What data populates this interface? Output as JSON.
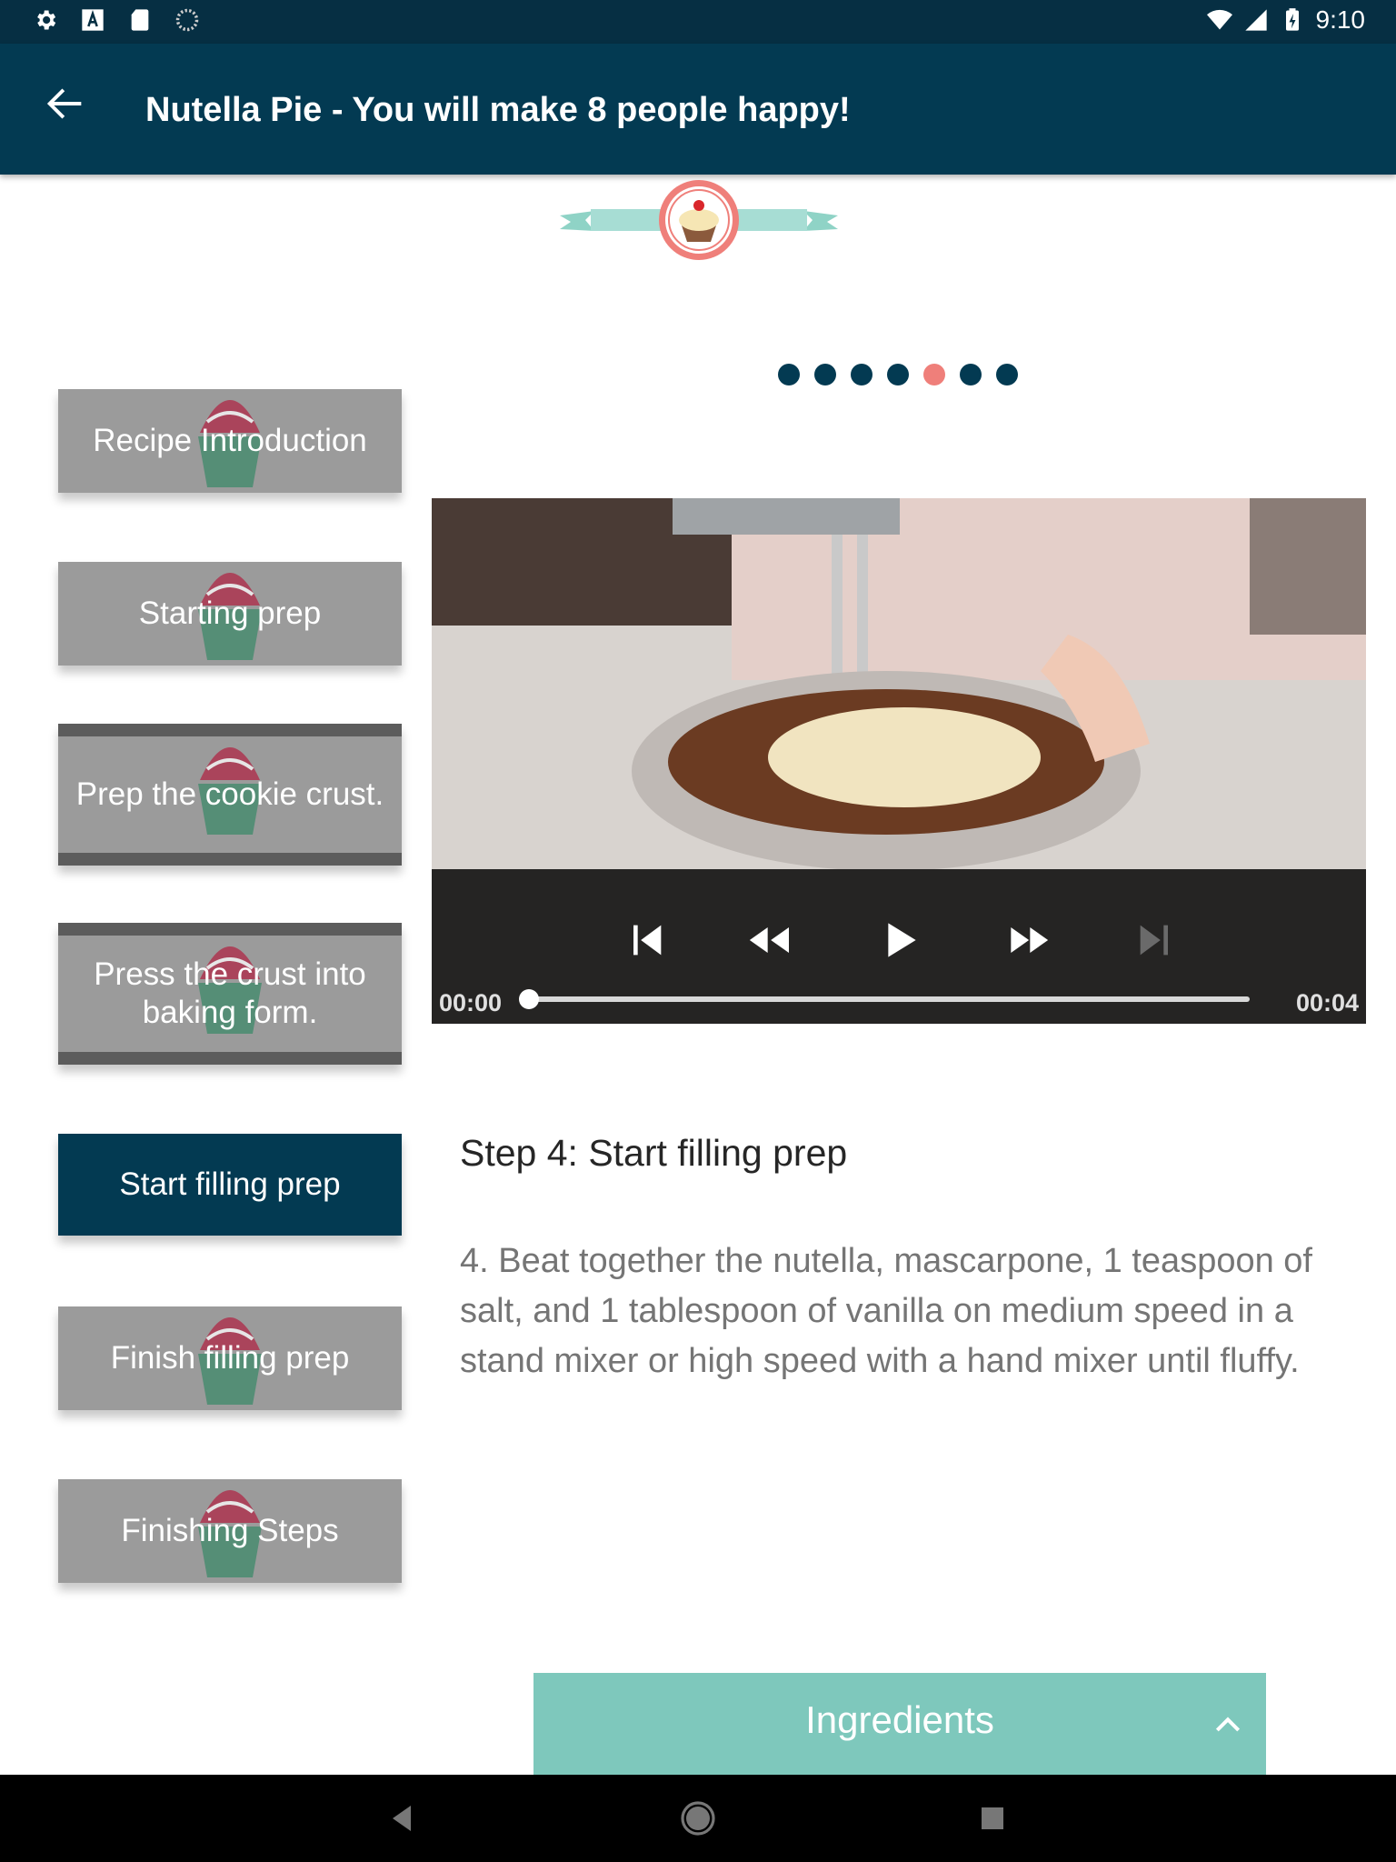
{
  "status_bar": {
    "time": "9:10",
    "icons": [
      "settings-icon",
      "a-badge-icon",
      "sd-card-icon",
      "sync-icon",
      "wifi-icon",
      "cell-signal-icon",
      "battery-charging-icon"
    ]
  },
  "app_bar": {
    "title": "Nutella Pie - You will make 8 people happy!",
    "back_icon": "arrow-left-icon"
  },
  "steps": [
    {
      "label": "Recipe Introduction",
      "active": false
    },
    {
      "label": "Starting prep",
      "active": false
    },
    {
      "label": "Prep the cookie crust.",
      "active": false
    },
    {
      "label": "Press the crust into baking form.",
      "active": false
    },
    {
      "label": "Start filling prep",
      "active": true
    },
    {
      "label": "Finish filling prep",
      "active": false
    },
    {
      "label": "Finishing Steps",
      "active": false
    }
  ],
  "page_indicator": {
    "count": 7,
    "active_index": 4
  },
  "video": {
    "current_time": "00:00",
    "duration": "00:04",
    "progress": 0.0,
    "controls": [
      "skip-previous-icon",
      "rewind-icon",
      "play-icon",
      "fast-forward-icon",
      "skip-next-icon"
    ]
  },
  "step_detail": {
    "title": "Step 4: Start filling prep",
    "description": "4. Beat together the nutella, mascarpone, 1 teaspoon of salt, and 1 tablespoon of vanilla on medium speed in a stand mixer or high speed with a hand mixer until fluffy."
  },
  "ingredients": {
    "label": "Ingredients"
  },
  "colors": {
    "status_bar": "#062f43",
    "app_bar": "#033a52",
    "active_step": "#033a52",
    "inactive_step": "#9b9b9b",
    "dot_active": "#ef7f7a",
    "dot_inactive": "#033a52",
    "ingredients_bar": "#7ec8bc"
  }
}
